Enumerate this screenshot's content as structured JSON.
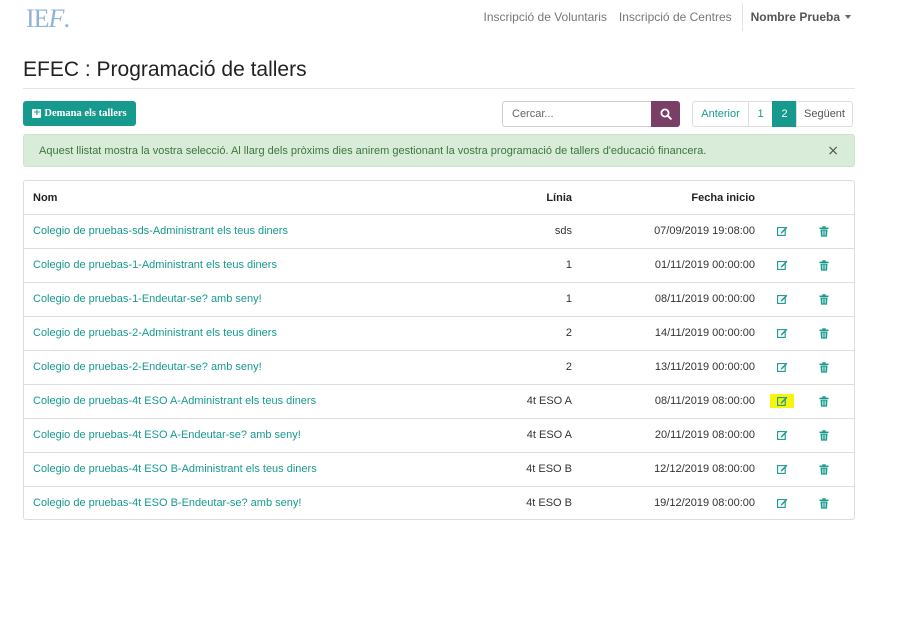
{
  "navbar": {
    "logo_main": "IE",
    "logo_f": "F",
    "logo_dot": ".",
    "links": [
      "Inscripció de Voluntaris",
      "Inscripció de Centres"
    ],
    "user": "Nombre Prueba"
  },
  "page": {
    "title": "EFEC : Programació de tallers"
  },
  "toolbar": {
    "request_label": "Demana els tallers",
    "search_placeholder": "Cercar...",
    "pagination": {
      "prev": "Anterior",
      "pages": [
        "1",
        "2"
      ],
      "current": "2",
      "next": "Següent"
    }
  },
  "alert": {
    "text": "Aquest llistat mostra la vostra selecció. Al llarg dels pròxims dies anirem gestionant la vostra programació de tallers d'educació financera.",
    "close": "×"
  },
  "table": {
    "headers": {
      "nom": "Nom",
      "linia": "Línia",
      "fecha": "Fecha inicio"
    },
    "rows": [
      {
        "nom": "Colegio de pruebas-sds-Administrant els teus diners",
        "linia": "sds",
        "fecha": "07/09/2019 19:08:00",
        "edit_highlighted": false
      },
      {
        "nom": "Colegio de pruebas-1-Administrant els teus diners",
        "linia": "1",
        "fecha": "01/11/2019 00:00:00",
        "edit_highlighted": false
      },
      {
        "nom": "Colegio de pruebas-1-Endeutar-se? amb seny!",
        "linia": "1",
        "fecha": "08/11/2019 00:00:00",
        "edit_highlighted": false
      },
      {
        "nom": "Colegio de pruebas-2-Administrant els teus diners",
        "linia": "2",
        "fecha": "14/11/2019 00:00:00",
        "edit_highlighted": false
      },
      {
        "nom": "Colegio de pruebas-2-Endeutar-se? amb seny!",
        "linia": "2",
        "fecha": "13/11/2019 00:00:00",
        "edit_highlighted": false
      },
      {
        "nom": "Colegio de pruebas-4t ESO A-Administrant els teus diners",
        "linia": "4t ESO A",
        "fecha": "08/11/2019 08:00:00",
        "edit_highlighted": true
      },
      {
        "nom": "Colegio de pruebas-4t ESO A-Endeutar-se? amb seny!",
        "linia": "4t ESO A",
        "fecha": "20/11/2019 08:00:00",
        "edit_highlighted": false
      },
      {
        "nom": "Colegio de pruebas-4t ESO B-Administrant els teus diners",
        "linia": "4t ESO B",
        "fecha": "12/12/2019 08:00:00",
        "edit_highlighted": false
      },
      {
        "nom": "Colegio de pruebas-4t ESO B-Endeutar-se? amb seny!",
        "linia": "4t ESO B",
        "fecha": "19/12/2019 08:00:00",
        "edit_highlighted": false
      }
    ]
  },
  "icons": {
    "search": "search-icon",
    "edit": "edit-icon",
    "delete": "trash-icon",
    "add": "plus-square-icon"
  },
  "colors": {
    "primary": "#169a8e",
    "search_button": "#7a3f67",
    "alert_bg": "#d8ecd9",
    "alert_text": "#3c763d",
    "highlight": "#f5f510",
    "logo": "#8fb3d6"
  }
}
